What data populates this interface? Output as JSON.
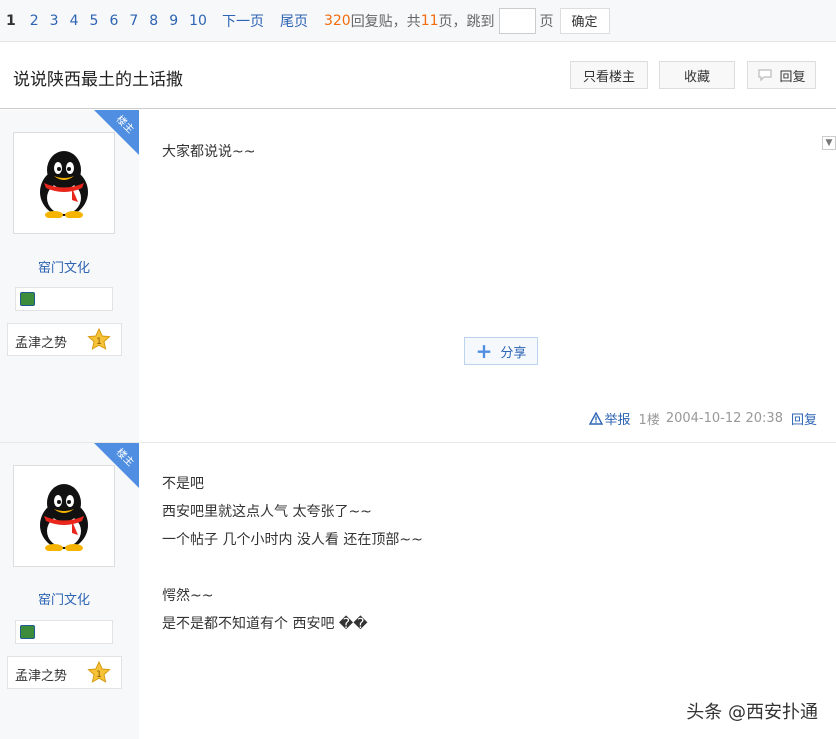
{
  "pager": {
    "current": "1",
    "pages": [
      "2",
      "3",
      "4",
      "5",
      "6",
      "7",
      "8",
      "9",
      "10"
    ],
    "next": "下一页",
    "last": "尾页",
    "reply_count": "320",
    "reply_text": "回复贴，共",
    "total_pages": "11",
    "jump_text": "页，跳到",
    "page_unit": "页",
    "confirm": "确定"
  },
  "thread": {
    "title": "说说陕西最土的土话撒",
    "only_owner": "只看楼主",
    "favorite": "收藏",
    "reply": "回复"
  },
  "posts": [
    {
      "author": "窑门文化",
      "badge": "楼主",
      "bar_name": "孟津之势",
      "level": "1",
      "lines": [
        "大家都说说~~"
      ],
      "share": "分享",
      "report": "举报",
      "floor": "1楼",
      "time": "2004-10-12 20:38",
      "reply": "回复"
    },
    {
      "author": "窑门文化",
      "badge": "楼主",
      "bar_name": "孟津之势",
      "level": "1",
      "lines": [
        "不是吧",
        "西安吧里就这点人气 太夸张了~~",
        "一个帖子 几个小时内 没人看 还在顶部~~",
        "",
        "愕然~~",
        "是不是都不知道有个 西安吧 ��"
      ]
    }
  ],
  "watermark": "头条 @西安扑通",
  "icons": [
    "penguin-avatar-icon",
    "level-badge-icon",
    "star-level-icon",
    "dropdown-arrow-icon",
    "reply-bubble-icon",
    "warning-icon",
    "plus-share-icon"
  ]
}
